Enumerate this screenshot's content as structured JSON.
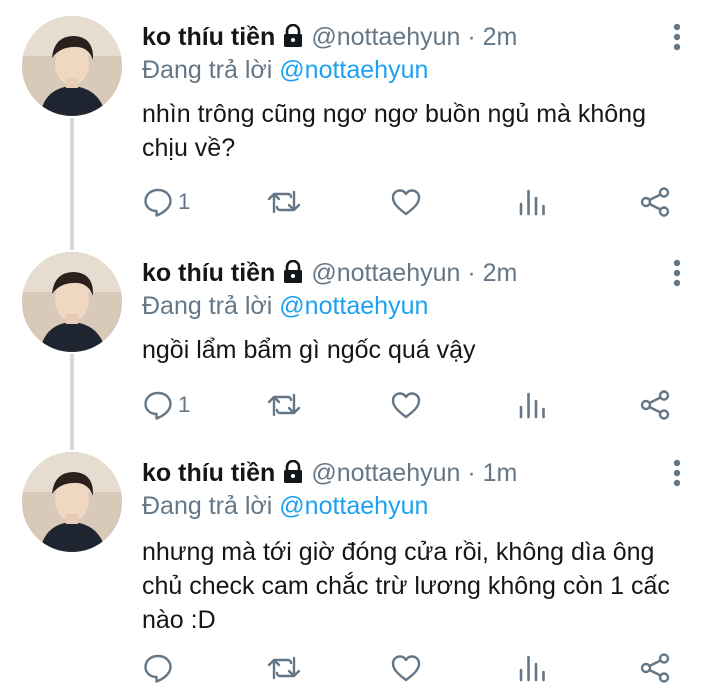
{
  "tweets": [
    {
      "name": "ko thíu tiền",
      "handle": "@nottaehyun",
      "time": "2m",
      "reply_prefix": "Đang trả lời",
      "reply_to": "@nottaehyun",
      "text": "nhìn trông cũng ngơ ngơ buồn ngủ mà không chịu về?",
      "reply_count": "1"
    },
    {
      "name": "ko thíu tiền",
      "handle": "@nottaehyun",
      "time": "2m",
      "reply_prefix": "Đang trả lời",
      "reply_to": "@nottaehyun",
      "text": "ngồi lẩm bẩm gì ngốc quá vậy",
      "reply_count": "1"
    },
    {
      "name": "ko thíu tiền",
      "handle": "@nottaehyun",
      "time": "1m",
      "reply_prefix": "Đang trả lời",
      "reply_to": "@nottaehyun",
      "text": "nhưng mà tới giờ đóng cửa rồi, không dìa ông chủ check cam chắc trừ lương không còn 1 cấc nào :D",
      "reply_count": ""
    }
  ],
  "separator": " · ",
  "colors": {
    "accent": "#1da1f2",
    "muted": "#657786",
    "thread_line": "#cfd9de"
  },
  "icons": [
    "lock-icon",
    "more-vertical-icon",
    "reply-icon",
    "retweet-icon",
    "like-icon",
    "analytics-icon",
    "share-icon"
  ]
}
